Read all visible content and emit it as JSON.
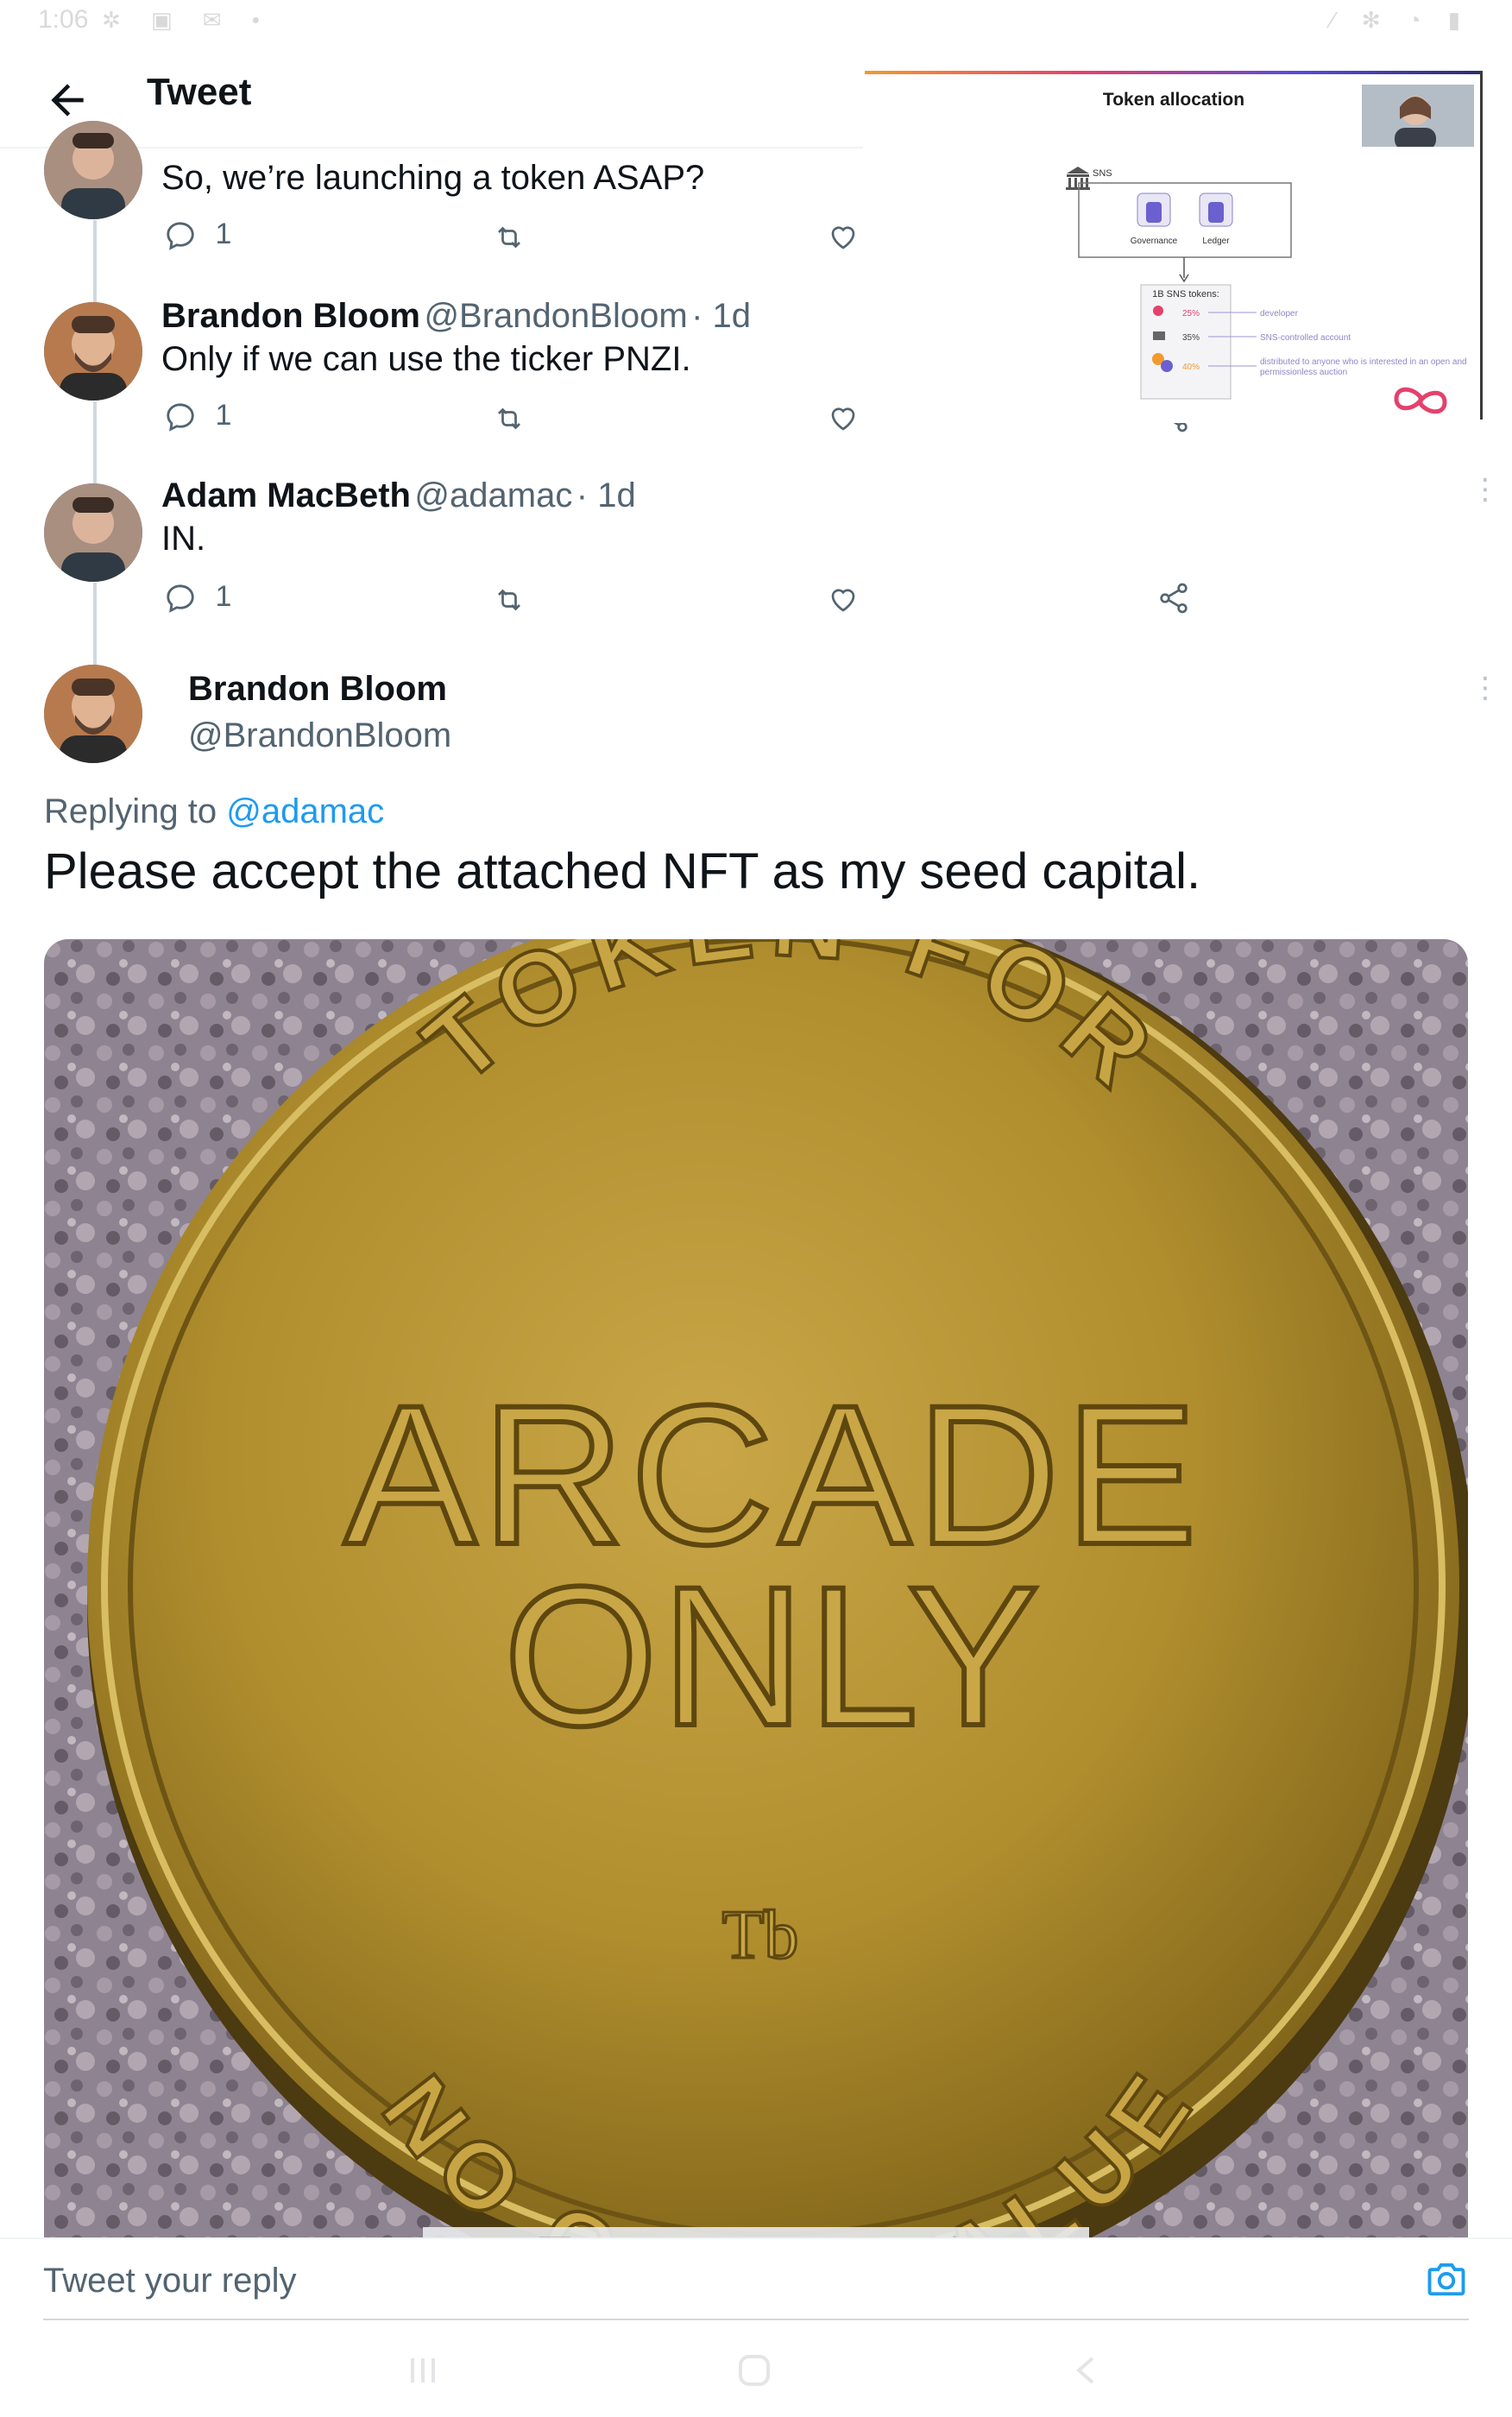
{
  "status_bar": {
    "time": "1:06"
  },
  "header": {
    "title": "Tweet"
  },
  "slide": {
    "title": "Token allocation",
    "sns_label": "SNS",
    "governance_label": "Governance",
    "ledger_label": "Ledger",
    "tokens_heading": "1B SNS tokens:",
    "rows": [
      {
        "pct": "25%",
        "desc": "developer",
        "color": "#e4416d"
      },
      {
        "pct": "35%",
        "desc": "SNS-controlled account",
        "color": "#555555"
      },
      {
        "pct": "40%",
        "desc": "distributed to anyone who is interested in an open and permissionless auction",
        "color": "#f29a2e"
      }
    ]
  },
  "tweets": [
    {
      "text": "So, we’re launching a token ASAP?",
      "reply_count": "1"
    },
    {
      "name": "Brandon Bloom",
      "handle": "@BrandonBloom",
      "time": "· 1d",
      "text": "Only if we can use the ticker PNZI.",
      "reply_count": "1"
    },
    {
      "name": "Adam MacBeth",
      "handle": "@adamac",
      "time": "· 1d",
      "text": "IN.",
      "reply_count": "1"
    }
  ],
  "main_tweet": {
    "name": "Brandon Bloom",
    "handle": "@BrandonBloom",
    "replying_prefix": "Replying to",
    "replying_to": "@adamac",
    "text": "Please accept the attached NFT as my seed capital.",
    "coin": {
      "top_text": "TOKEN FOR",
      "center_line1": "ARCADE",
      "center_line2": "ONLY",
      "bottom_text": "NO CASH VALUE",
      "mark": "Tb"
    }
  },
  "composer": {
    "placeholder": "Tweet your reply"
  },
  "colors": {
    "accent": "#1d9bf0",
    "link": "#1d9bf0",
    "secondary_text": "#536471",
    "coin_gold": "#b8952e"
  }
}
